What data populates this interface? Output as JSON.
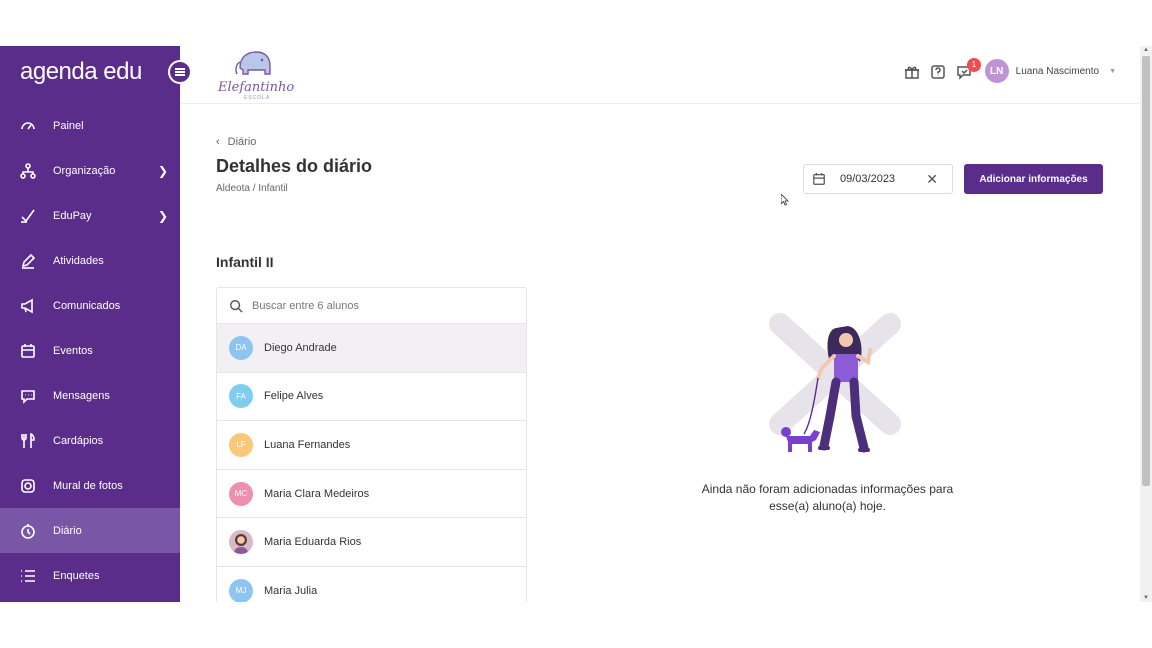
{
  "sidebar": {
    "brand_first": "agenda",
    "brand_second": "edu",
    "items": [
      {
        "label": "Painel",
        "icon": "gauge-icon"
      },
      {
        "label": "Organização",
        "icon": "org-chart-icon",
        "has_children": true
      },
      {
        "label": "EduPay",
        "icon": "check-pay-icon",
        "has_children": true
      },
      {
        "label": "Atividades",
        "icon": "pencil-icon"
      },
      {
        "label": "Comunicados",
        "icon": "megaphone-icon"
      },
      {
        "label": "Eventos",
        "icon": "calendar-icon"
      },
      {
        "label": "Mensagens",
        "icon": "chat-icon"
      },
      {
        "label": "Cardápios",
        "icon": "cutlery-icon"
      },
      {
        "label": "Mural de fotos",
        "icon": "camera-icon"
      },
      {
        "label": "Diário",
        "icon": "diary-icon",
        "active": true
      },
      {
        "label": "Enquetes",
        "icon": "list-icon"
      }
    ]
  },
  "topbar": {
    "school_name": "Elefantinho",
    "school_sub": "ESCOLA",
    "notifications_count": "1",
    "user_initials": "LN",
    "user_name": "Luana Nascimento"
  },
  "page": {
    "breadcrumb": "Diário",
    "title": "Detalhes do diário",
    "subpath": "Aldeota / Infantil",
    "date": "09/03/2023",
    "add_button": "Adicionar informações",
    "class_title": "Infantil II",
    "search_placeholder": "Buscar entre 6 alunos",
    "empty_message": "Ainda não foram adicionadas informações para esse(a) aluno(a) hoje."
  },
  "students": [
    {
      "initials": "DA",
      "name": "Diego Andrade",
      "color": "#8ec5f0",
      "selected": true
    },
    {
      "initials": "FA",
      "name": "Felipe Alves",
      "color": "#7fcdf0"
    },
    {
      "initials": "LF",
      "name": "Luana Fernandes",
      "color": "#f9c97a"
    },
    {
      "initials": "MC",
      "name": "Maria Clara Medeiros",
      "color": "#ee8fae"
    },
    {
      "initials": "",
      "name": "Maria Eduarda Rios",
      "color": "#d9b9c9",
      "photo": true
    },
    {
      "initials": "MJ",
      "name": "Maria Julia",
      "color": "#8ec5f0"
    }
  ],
  "colors": {
    "primary": "#5a2d8a",
    "sidebar_active": "#7a56a6",
    "badge": "#f04e4e"
  }
}
